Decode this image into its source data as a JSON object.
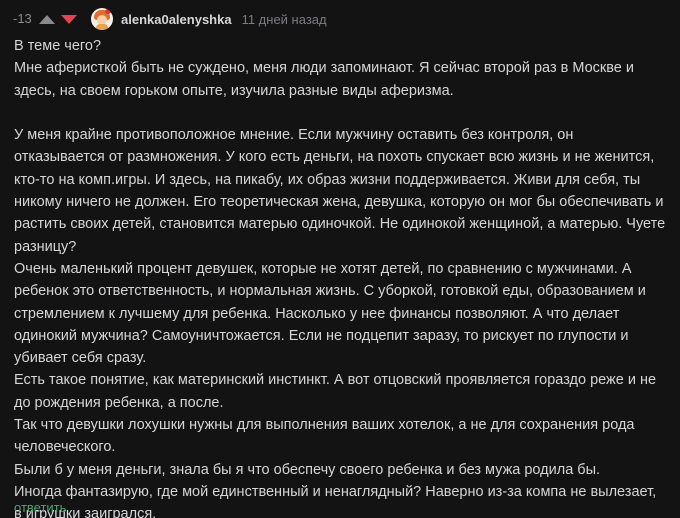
{
  "comment": {
    "rating": "-13",
    "username": "alenka0alenyshka",
    "timestamp": "11 дней назад",
    "lines": [
      "В теме чего?",
      "Мне аферисткой быть не суждено, меня люди запоминают. Я сейчас второй раз в Москве и здесь, на своем горьком опыте, изучила разные виды аферизма.",
      "",
      "У меня крайне противоположное мнение. Если мужчину оставить без контроля, он отказывается от размножения. У кого есть деньги, на похоть спускает всю жизнь и не женится, кто-то на комп.игры. И здесь, на пикабу, их образ жизни поддерживается. Живи для себя, ты никому ничего не должен. Его теоретическая жена, девушка, которую он мог бы обеспечивать и растить своих детей, становится матерью одиночкой. Не одинокой женщиной, а матерью. Чуете разницу?",
      "Очень маленький процент девушек, которые не хотят детей, по сравнению с мужчинами. А ребенок это ответственность, и нормальная жизнь. С уборкой, готовкой еды, образованием и стремлением к лучшему для ребенка. Насколько у нее финансы позволяют. А что делает одинокий мужчина? Самоуничтожается. Если не подцепит заразу, то рискует по глупости и убивает себя сразу.",
      "Есть такое понятие, как материнский инстинкт. А вот отцовский проявляется гораздо реже и не до рождения ребенка, а после.",
      "Так что девушки лохушки нужны для выполнения ваших хотелок, а не для сохранения рода человеческого.",
      "Были б у меня деньги, знала бы я что обеспечу своего ребенка и без мужа родила бы.",
      "Иногда фантазирую, где мой единственный и ненаглядный? Наверно из-за компа не вылезает, в игрушки заигрался."
    ],
    "reply_label": "ответить"
  },
  "colors": {
    "background": "#131314",
    "text": "#d6d6d8",
    "downvote": "#e8424d",
    "reply": "#4aa86a"
  }
}
